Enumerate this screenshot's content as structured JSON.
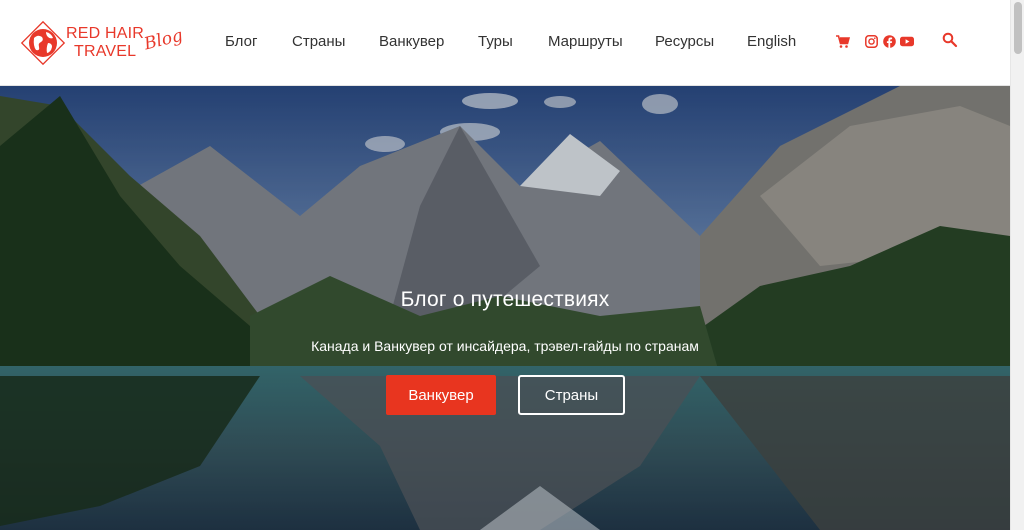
{
  "header": {
    "logo": {
      "line1": "RED HAIR",
      "line2": "TRAVEL",
      "script": "Blog"
    },
    "nav": [
      {
        "label": "Блог"
      },
      {
        "label": "Страны"
      },
      {
        "label": "Ванкувер"
      },
      {
        "label": "Туры"
      },
      {
        "label": "Маршруты"
      },
      {
        "label": "Ресурсы"
      },
      {
        "label": "English"
      }
    ],
    "icons": [
      "cart-icon",
      "instagram-icon",
      "facebook-icon",
      "youtube-icon",
      "search-icon"
    ],
    "accent_color": "#e8382a"
  },
  "hero": {
    "title": "Блог о путешествиях",
    "subtitle": "Канада и Ванкувер от инсайдера, трэвел-гайды по странам",
    "primary_button": "Ванкувер",
    "secondary_button": "Страны"
  }
}
